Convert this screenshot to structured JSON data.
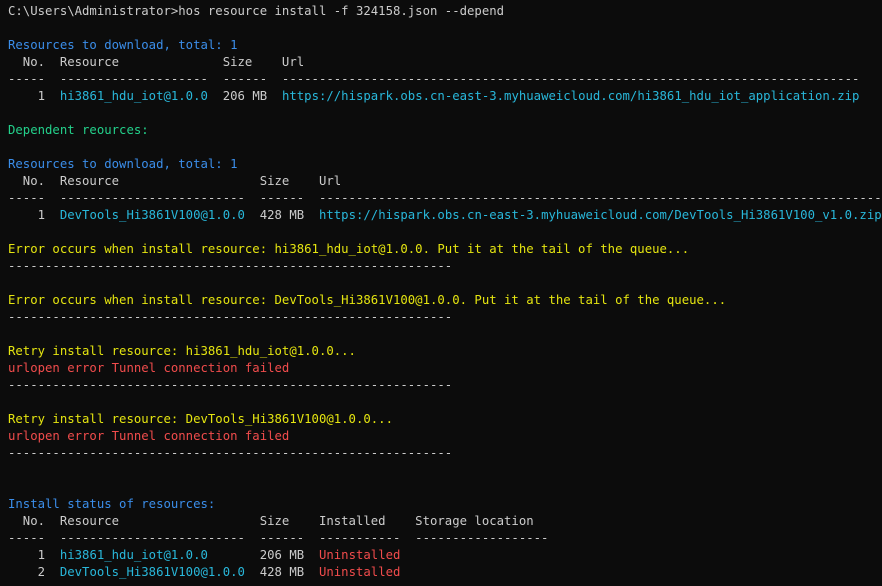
{
  "lines": [
    [
      {
        "t": "C:\\Users\\Administrator>hos resource install -f 324158.json --depend",
        "c": "def"
      }
    ],
    [],
    [
      {
        "t": "Resources to download, total: 1",
        "c": "blue"
      }
    ],
    [
      {
        "t": "  No.  Resource              Size    Url",
        "c": "def"
      }
    ],
    [
      {
        "t": "-----  --------------------  ------  ------------------------------------------------------------------------------",
        "c": "def"
      }
    ],
    [
      {
        "t": "    1  ",
        "c": "def"
      },
      {
        "t": "hi3861_hdu_iot@1.0.0",
        "c": "cyan"
      },
      {
        "t": "  206 MB  ",
        "c": "def"
      },
      {
        "t": "https://hispark.obs.cn-east-3.myhuaweicloud.com/hi3861_hdu_iot_application.zip",
        "c": "cyan"
      }
    ],
    [],
    [
      {
        "t": "Dependent reources:",
        "c": "grn"
      }
    ],
    [],
    [
      {
        "t": "Resources to download, total: 1",
        "c": "blue"
      }
    ],
    [
      {
        "t": "  No.  Resource                   Size    Url",
        "c": "def"
      }
    ],
    [
      {
        "t": "-----  -------------------------  ------  -----------------------------------------------------------------------------",
        "c": "def"
      }
    ],
    [
      {
        "t": "    1  ",
        "c": "def"
      },
      {
        "t": "DevTools_Hi3861V100@1.0.0",
        "c": "cyan"
      },
      {
        "t": "  428 MB  ",
        "c": "def"
      },
      {
        "t": "https://hispark.obs.cn-east-3.myhuaweicloud.com/DevTools_Hi3861V100_v1.0.zip",
        "c": "cyan"
      }
    ],
    [],
    [
      {
        "t": "Error occurs when install resource: hi3861_hdu_iot@1.0.0. Put it at the tail of the queue...",
        "c": "yel"
      }
    ],
    [
      {
        "t": "------------------------------------------------------------",
        "c": "gry"
      }
    ],
    [],
    [
      {
        "t": "Error occurs when install resource: DevTools_Hi3861V100@1.0.0. Put it at the tail of the queue...",
        "c": "yel"
      }
    ],
    [
      {
        "t": "------------------------------------------------------------",
        "c": "gry"
      }
    ],
    [],
    [
      {
        "t": "Retry install resource: hi3861_hdu_iot@1.0.0...",
        "c": "yel"
      }
    ],
    [
      {
        "t": "urlopen error Tunnel connection failed",
        "c": "red"
      }
    ],
    [
      {
        "t": "------------------------------------------------------------",
        "c": "gry"
      }
    ],
    [],
    [
      {
        "t": "Retry install resource: DevTools_Hi3861V100@1.0.0...",
        "c": "yel"
      }
    ],
    [
      {
        "t": "urlopen error Tunnel connection failed",
        "c": "red"
      }
    ],
    [
      {
        "t": "------------------------------------------------------------",
        "c": "gry"
      }
    ],
    [],
    [],
    [
      {
        "t": "Install status of resources:",
        "c": "blue"
      }
    ],
    [
      {
        "t": "  No.  Resource                   Size    Installed    Storage location",
        "c": "def"
      }
    ],
    [
      {
        "t": "-----  -------------------------  ------  -----------  ------------------",
        "c": "def"
      }
    ],
    [
      {
        "t": "    1  ",
        "c": "def"
      },
      {
        "t": "hi3861_hdu_iot@1.0.0",
        "c": "cyan"
      },
      {
        "t": "       206 MB  ",
        "c": "def"
      },
      {
        "t": "Uninstalled",
        "c": "red"
      }
    ],
    [
      {
        "t": "    2  ",
        "c": "def"
      },
      {
        "t": "DevTools_Hi3861V100@1.0.0",
        "c": "cyan"
      },
      {
        "t": "  428 MB  ",
        "c": "def"
      },
      {
        "t": "Uninstalled",
        "c": "red"
      }
    ]
  ]
}
